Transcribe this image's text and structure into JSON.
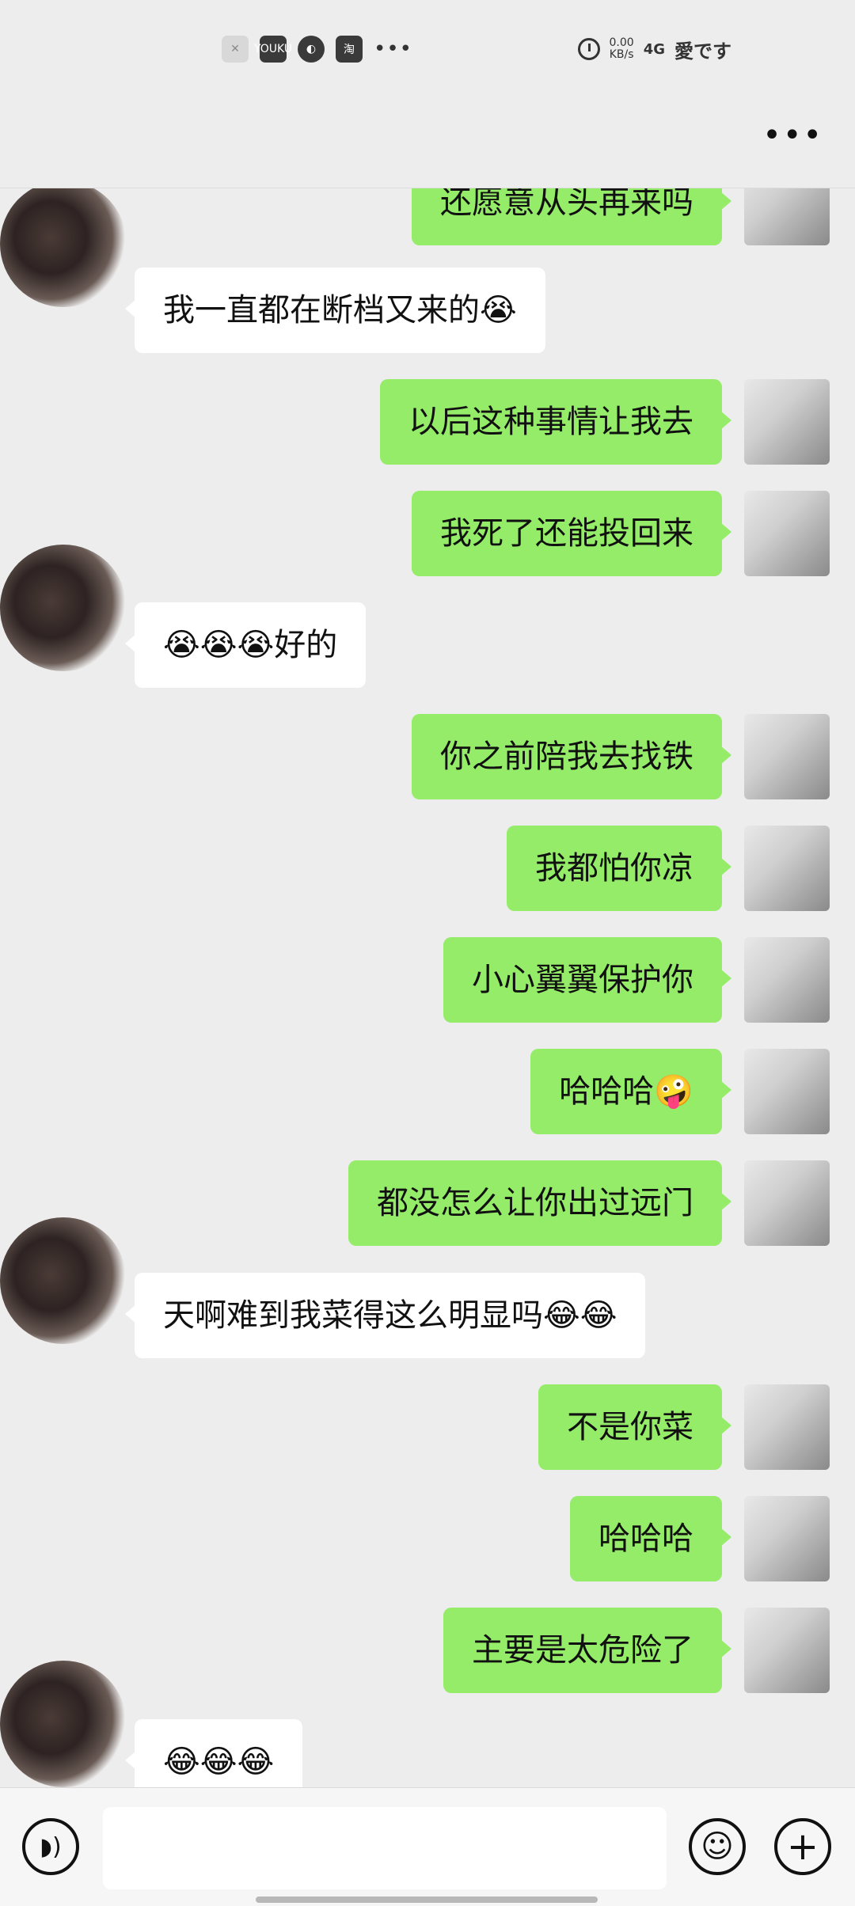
{
  "status_bar": {
    "apps": [
      "YOUKU",
      "淘"
    ],
    "more": "•••",
    "net_speed_value": "0.00",
    "net_speed_unit": "KB/s",
    "network": "4G",
    "carrier": "愛です"
  },
  "header": {
    "more": "•••"
  },
  "messages": [
    {
      "from": "me",
      "text": "还愿意从头再来吗"
    },
    {
      "from": "other",
      "text": "我一直都在断档又来的😭"
    },
    {
      "from": "me",
      "text": "以后这种事情让我去"
    },
    {
      "from": "me",
      "text": "我死了还能投回来"
    },
    {
      "from": "other",
      "text": "😭😭😭好的"
    },
    {
      "from": "me",
      "text": "你之前陪我去找铁"
    },
    {
      "from": "me",
      "text": "我都怕你凉"
    },
    {
      "from": "me",
      "text": "小心翼翼保护你"
    },
    {
      "from": "me",
      "text": "哈哈哈🤪"
    },
    {
      "from": "me",
      "text": "都没怎么让你出过远门"
    },
    {
      "from": "other",
      "text": "天啊难到我菜得这么明显吗😂😂"
    },
    {
      "from": "me",
      "text": "不是你菜"
    },
    {
      "from": "me",
      "text": "哈哈哈"
    },
    {
      "from": "me",
      "text": "主要是太危险了"
    },
    {
      "from": "other",
      "text": "😂😂😂"
    }
  ],
  "input_bar": {
    "voice_icon": "voice-icon",
    "emoji_icon": "emoji-icon",
    "plus_icon": "plus-icon",
    "emoji_glyph": "☺",
    "plus_glyph": "+",
    "voice_glyph": "◗)"
  }
}
